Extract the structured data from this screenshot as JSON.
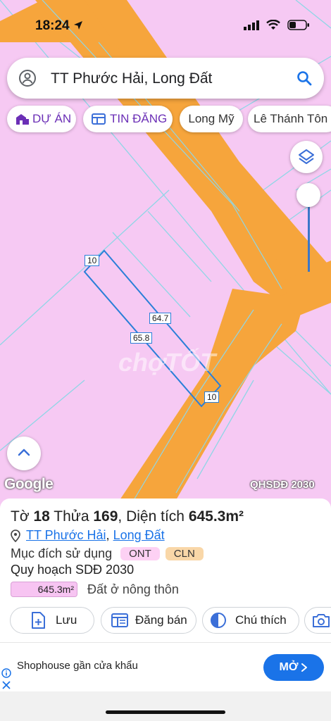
{
  "status_bar": {
    "time": "18:24"
  },
  "search": {
    "query": "TT Phước Hải, Long Đất"
  },
  "chips": [
    {
      "label": "DỰ ÁN"
    },
    {
      "label": "TIN ĐĂNG"
    },
    {
      "label": "Long Mỹ"
    },
    {
      "label": "Lê Thánh Tôn"
    }
  ],
  "map": {
    "dimension_labels": [
      "10",
      "64.7",
      "65.8",
      "10"
    ],
    "watermark": "chợTỐT",
    "google_logo": "Google",
    "layer_name": "QHSDĐ 2030"
  },
  "parcel": {
    "title_prefix": "Tờ",
    "sheet": "18",
    "plot_word": "Thửa",
    "plot": "169",
    "area_word": ", Diện tích",
    "area": "645.3m²",
    "ward": "TT Phước Hải",
    "separator": ",",
    "district": "Long Đất",
    "purpose_label": "Mục đích sử dụng",
    "purpose_tags": [
      {
        "code": "ONT",
        "color": "#fdd1f4"
      },
      {
        "code": "CLN",
        "color": "#f9d7a8"
      }
    ],
    "plan_label": "Quy hoạch SDĐ 2030",
    "plan_area": "645.3m²",
    "plan_type": "Đất ở nông thôn"
  },
  "actions": [
    {
      "label": "Lưu",
      "icon": "add-file-icon"
    },
    {
      "label": "Đăng bán",
      "icon": "listing-icon"
    },
    {
      "label": "Chú thích",
      "icon": "legend-icon"
    },
    {
      "label": "",
      "icon": "camera-icon"
    }
  ],
  "ad": {
    "text": "Shophouse gần cửa khẩu",
    "cta": "MỞ"
  },
  "colors": {
    "map_bg": "#f6c9f3",
    "road": "#f6a53c",
    "accent": "#1a73e8",
    "purple": "#6b2fb6"
  }
}
